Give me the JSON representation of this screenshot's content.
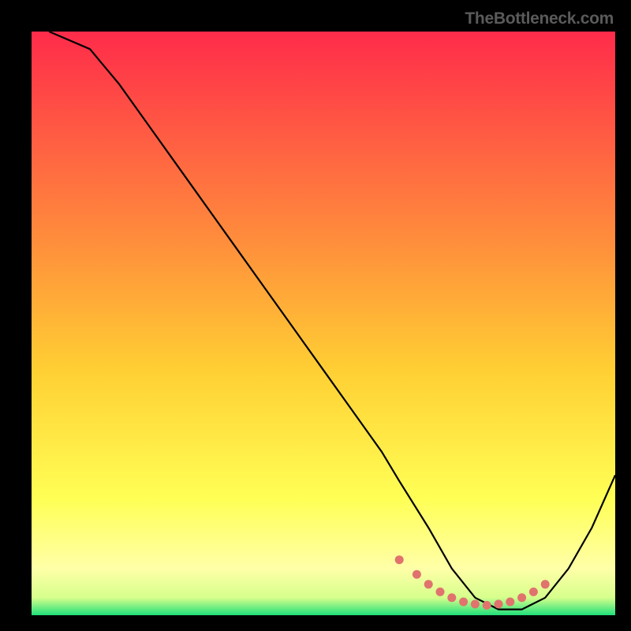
{
  "watermark": "TheBottleneck.com",
  "chart_data": {
    "type": "line",
    "title": "",
    "xlabel": "",
    "ylabel": "",
    "xlim": [
      0,
      100
    ],
    "ylim": [
      0,
      100
    ],
    "gradient": {
      "top": "#ff2b4a",
      "mid": "#ffcf33",
      "near_bottom": "#ffff9e",
      "bottom": "#1fe07a"
    },
    "curve": {
      "description": "V-shaped curve: descends from upper-left, reaches minimum near x≈78, rises toward right edge",
      "x": [
        3,
        10,
        15,
        20,
        25,
        30,
        35,
        40,
        45,
        50,
        55,
        60,
        63,
        68,
        72,
        76,
        80,
        84,
        88,
        92,
        96,
        100
      ],
      "y": [
        100,
        97,
        91,
        84,
        77,
        70,
        63,
        56,
        49,
        42,
        35,
        28,
        23,
        15,
        8,
        3,
        1,
        1,
        3,
        8,
        15,
        24
      ]
    },
    "markers": {
      "color": "#e0736e",
      "x": [
        63,
        66,
        68,
        70,
        72,
        74,
        76,
        78,
        80,
        82,
        84,
        86,
        88
      ],
      "y": [
        9.5,
        7.0,
        5.3,
        4.0,
        3.0,
        2.3,
        1.9,
        1.7,
        1.9,
        2.3,
        3.0,
        4.0,
        5.3
      ]
    }
  }
}
